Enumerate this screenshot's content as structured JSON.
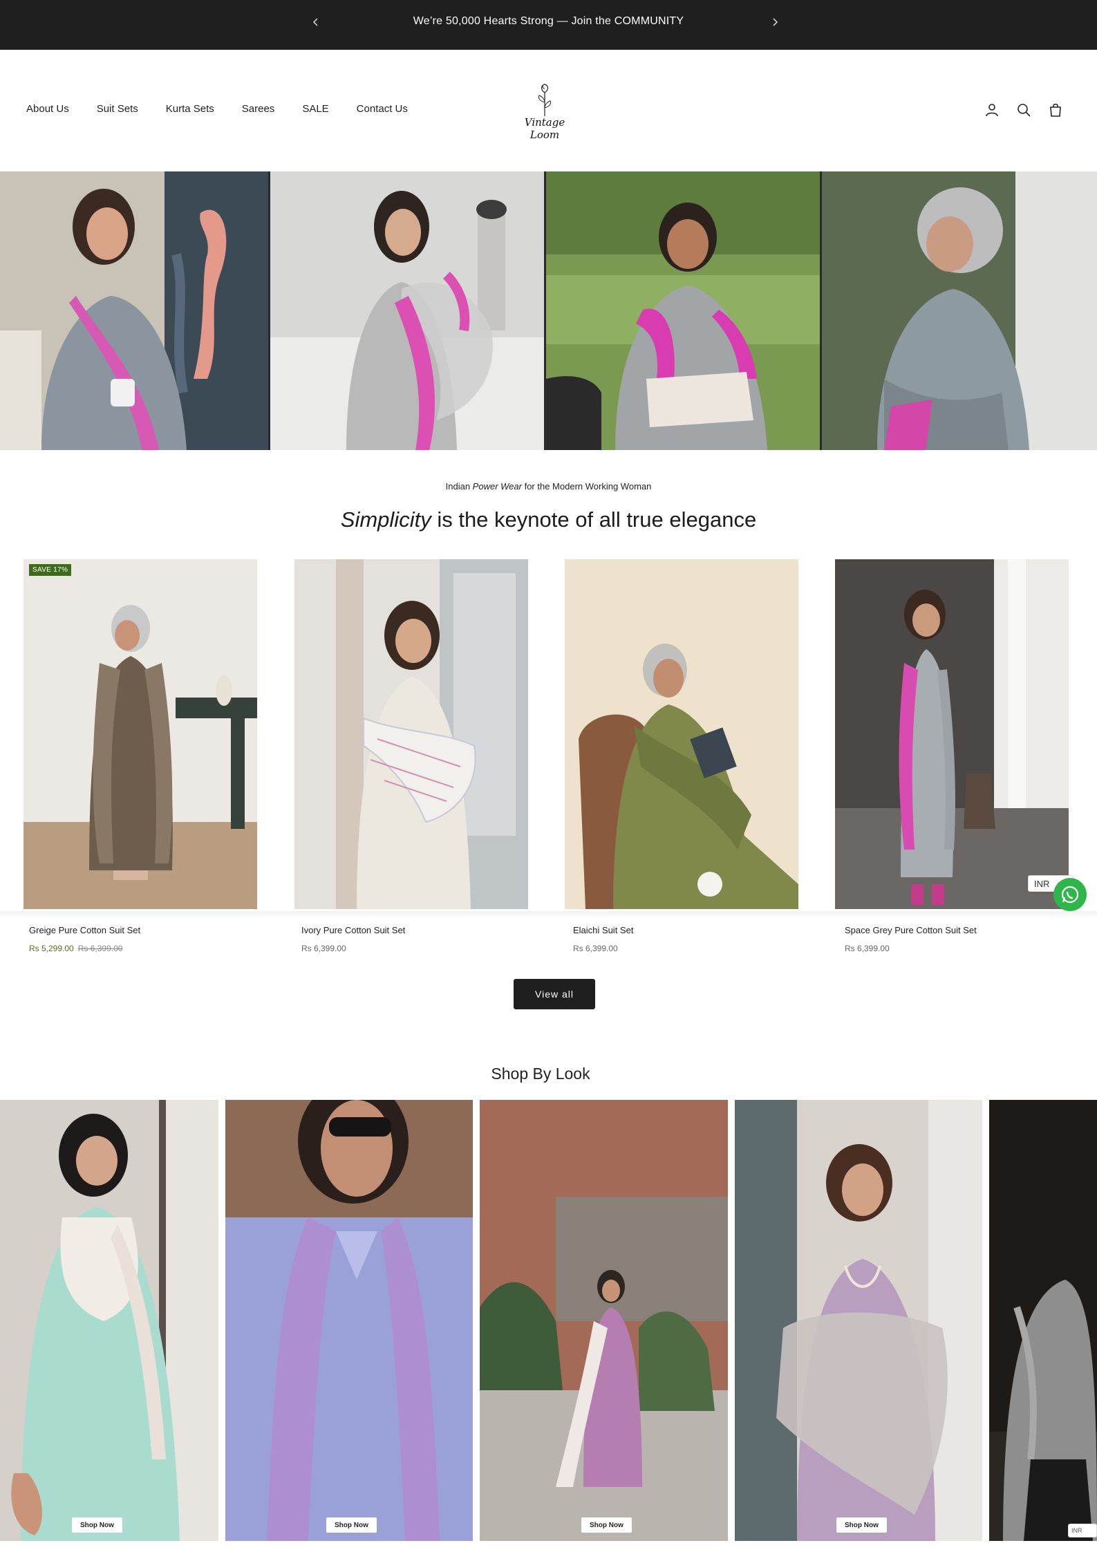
{
  "announcement": {
    "text": "We’re 50,000 Hearts Strong — Join the COMMUNITY",
    "prev_icon": "chevron-left-icon",
    "next_icon": "chevron-right-icon"
  },
  "header": {
    "nav": [
      {
        "label": "About Us"
      },
      {
        "label": "Suit Sets"
      },
      {
        "label": "Kurta Sets"
      },
      {
        "label": "Sarees"
      },
      {
        "label": "SALE"
      },
      {
        "label": "Contact Us"
      }
    ],
    "logo_text": "Vintage Loom",
    "icons": [
      "account-icon",
      "search-icon",
      "cart-icon"
    ]
  },
  "intro": {
    "tagline_pre": "Indian",
    "tagline_em": "Power Wear",
    "tagline_post": "for the Modern Working Woman",
    "headline_em": "Simplicity",
    "headline_rest": "is the keynote of all true elegance"
  },
  "products": [
    {
      "name": "Greige Pure Cotton Suit Set",
      "price": "Rs 5,299.00",
      "compare_price": "Rs 6,399.00",
      "badge": "SAVE 17%"
    },
    {
      "name": "Ivory Pure Cotton Suit Set",
      "price": "Rs 6,399.00"
    },
    {
      "name": "Elaichi Suit Set",
      "price": "Rs 6,399.00"
    },
    {
      "name": "Space Grey Pure Cotton Suit Set",
      "price": "Rs 6,399.00"
    }
  ],
  "view_all_label": "View all",
  "currency": "INR",
  "shop_by_look": {
    "title": "Shop By Look",
    "cards": [
      {
        "button": "Shop Now"
      },
      {
        "button": "Shop Now"
      },
      {
        "button": "Shop Now"
      },
      {
        "button": "Shop Now"
      }
    ]
  },
  "colors": {
    "announcement_bg": "#1f1f1f",
    "sale_badge": "#3d6b1b",
    "sale_price": "#5a6b1e",
    "whatsapp": "#2fb64a",
    "button_dark": "#1f1f1f"
  }
}
